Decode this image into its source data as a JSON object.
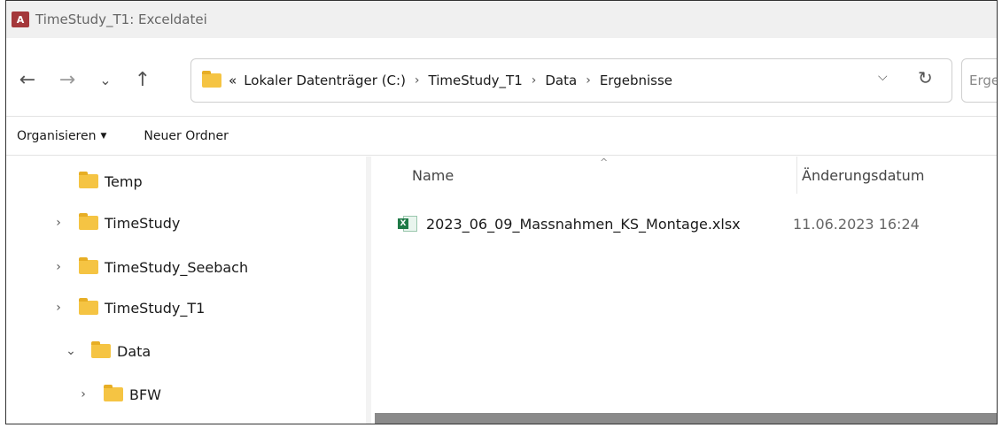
{
  "window": {
    "app_icon_letter": "A",
    "title": "TimeStudy_T1: Exceldatei"
  },
  "navigation": {
    "back_icon": "arrow-left",
    "forward_icon": "arrow-right",
    "recent_icon": "chevron-down",
    "up_icon": "arrow-up"
  },
  "address_bar": {
    "overflow": "«",
    "breadcrumbs": [
      "Lokaler Datenträger (C:)",
      "TimeStudy_T1",
      "Data",
      "Ergebnisse"
    ],
    "separator": "›",
    "dropdown_glyph": "⌵",
    "refresh_glyph": "↻"
  },
  "search": {
    "placeholder": "Ergeb"
  },
  "command_bar": {
    "organize_label": "Organisieren",
    "organize_caret": "▼",
    "new_folder_label": "Neuer Ordner"
  },
  "nav_tree": {
    "items": [
      {
        "label": "Temp",
        "chevron": ""
      },
      {
        "label": "TimeStudy",
        "chevron": "›"
      },
      {
        "label": "TimeStudy_Seebach",
        "chevron": "›"
      },
      {
        "label": "TimeStudy_T1",
        "chevron": "›"
      },
      {
        "label": "Data",
        "chevron": "⌄"
      },
      {
        "label": "BFW",
        "chevron": "›"
      }
    ]
  },
  "file_list": {
    "sort_indicator": "^",
    "columns": {
      "name": "Name",
      "modified": "Änderungsdatum"
    },
    "files": [
      {
        "name": "2023_06_09_Massnahmen_KS_Montage.xlsx",
        "modified": "11.06.2023 16:24",
        "icon_text": "X"
      }
    ]
  }
}
